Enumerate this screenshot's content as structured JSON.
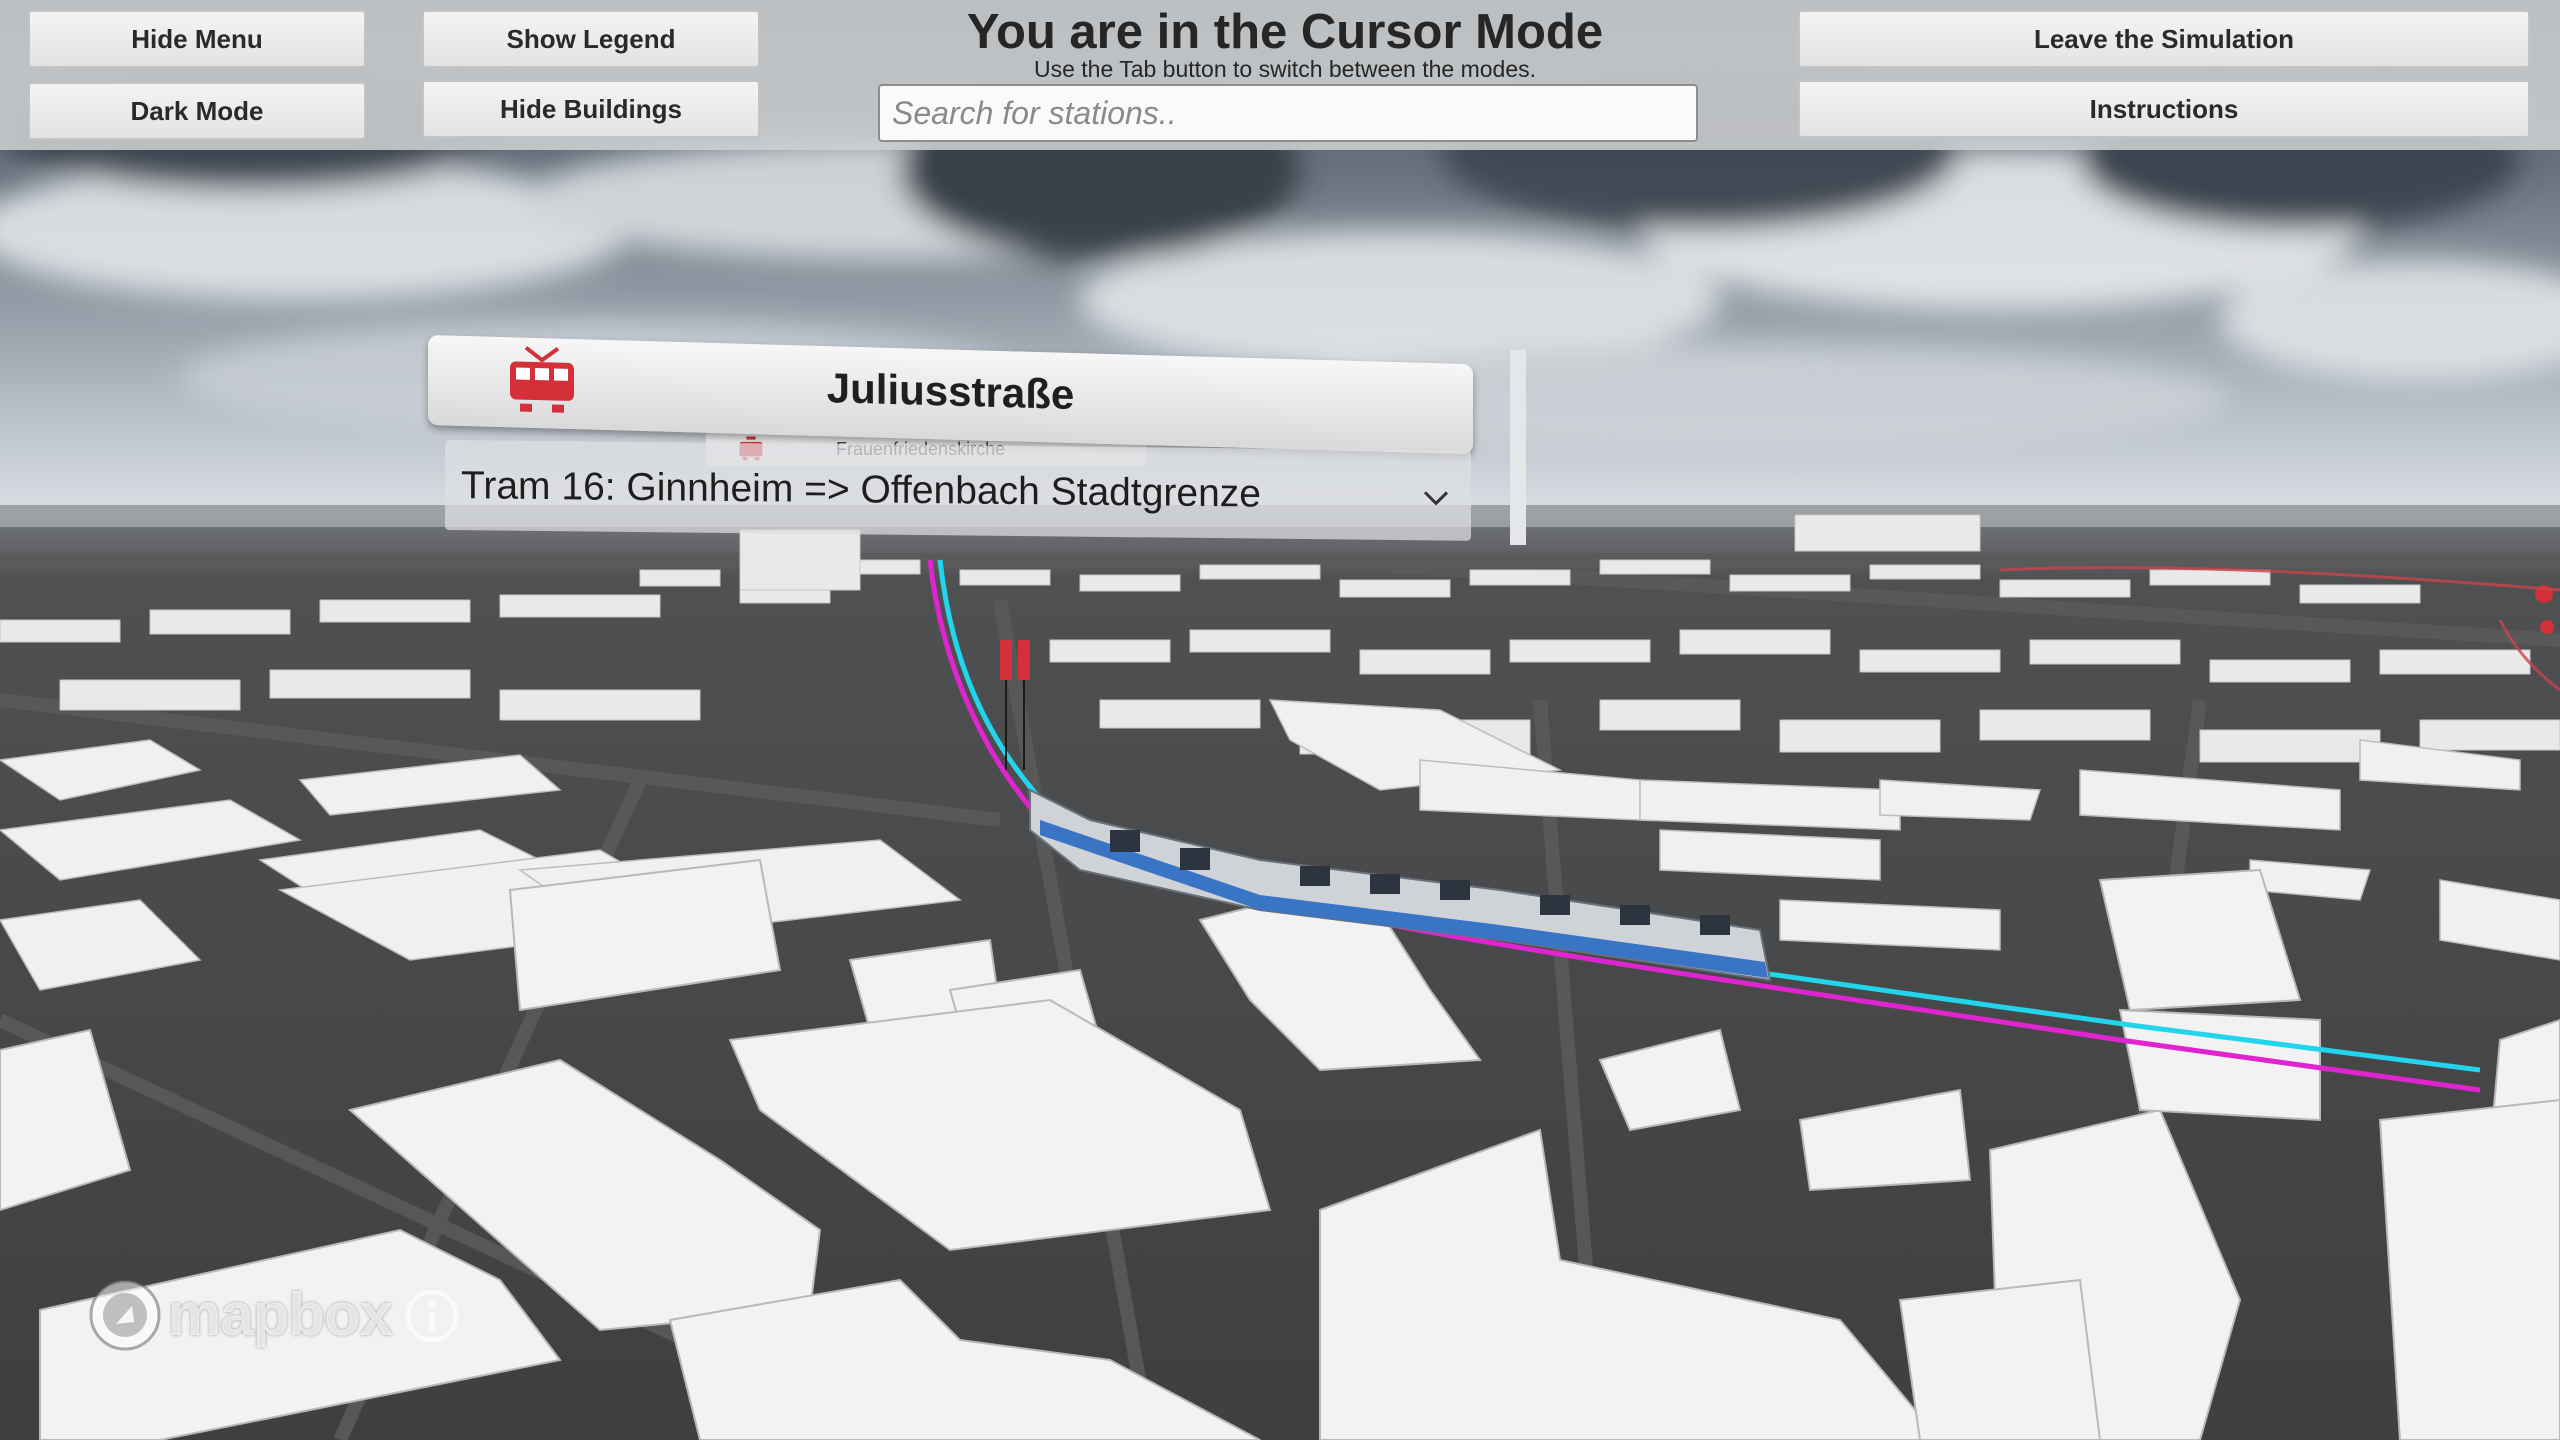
{
  "menu": {
    "hide_menu": "Hide Menu",
    "dark_mode": "Dark Mode",
    "show_legend": "Show Legend",
    "hide_buildings": "Hide Buildings",
    "leave_simulation": "Leave the Simulation",
    "instructions": "Instructions"
  },
  "mode": {
    "title": "You are in the Cursor Mode",
    "subtitle": "Use the Tab button to switch between the modes."
  },
  "search": {
    "placeholder": "Search for stations.."
  },
  "station": {
    "name": "Juliusstraße",
    "icon": "tram-icon",
    "background_station": "Frauenfriedenskirche",
    "selected_line": "Tram 16: Ginnheim => Offenbach Stadtgrenze"
  },
  "map": {
    "attribution": "mapbox",
    "route_colors": {
      "line_a": "#22d4ec",
      "line_b": "#e024d0"
    },
    "accent_red": "#d3303a"
  }
}
